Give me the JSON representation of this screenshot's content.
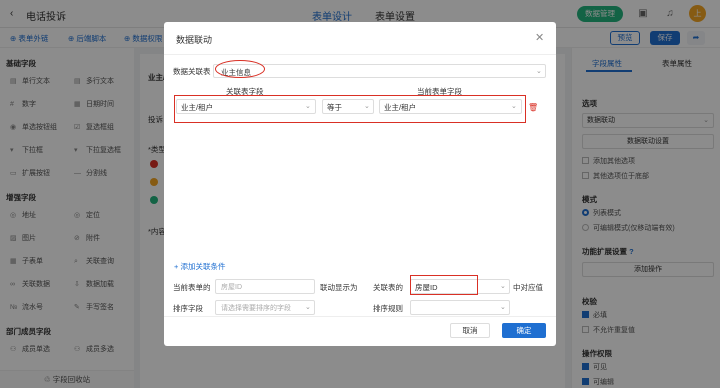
{
  "topbar": {
    "back_icon": "chevron-left-icon",
    "title": "电话投诉",
    "tabs": [
      {
        "label": "表单设计",
        "active": true
      },
      {
        "label": "表单设置",
        "active": false
      }
    ],
    "data_manage": "数据管理",
    "avatar_text": "上"
  },
  "subbar": {
    "items": [
      "表单外链",
      "后端脚本",
      "数据权限"
    ],
    "preview": "预览",
    "save": "保存"
  },
  "left": {
    "sections": [
      {
        "title": "基础字段",
        "fields": [
          "单行文本",
          "多行文本",
          "数字",
          "日期时间",
          "单选按钮组",
          "复选框组",
          "下拉框",
          "下拉复选框",
          "扩展按钮",
          "分割线"
        ]
      },
      {
        "title": "增强字段",
        "fields": [
          "地址",
          "定位",
          "图片",
          "附件",
          "子表单",
          "关联查询",
          "关联数据",
          "数据加载",
          "流水号",
          "手写签名"
        ]
      },
      {
        "title": "部门成员字段",
        "fields": [
          "成员单选",
          "成员多选"
        ]
      }
    ],
    "footer": "字段回收站"
  },
  "canvas": {
    "texts": [
      "业主/",
      "投诉",
      "*类型",
      "*内容"
    ]
  },
  "right": {
    "tabs": [
      {
        "label": "字段属性",
        "active": true
      },
      {
        "label": "表单属性",
        "active": false
      }
    ],
    "options_label": "选项",
    "options_select": "数据联动",
    "linkage_btn": "数据联动设置",
    "add_other": "添加其他选项",
    "other_bottom": "其他选项位于底部",
    "mode_label": "模式",
    "mode_list": "列表模式",
    "mode_edit": "可编辑模式(仅移动端有效)",
    "ext_label": "功能扩展设置",
    "add_action": "添加操作",
    "verify_label": "校验",
    "required": "必填",
    "no_dup": "不允许重复值",
    "perm_label": "操作权限",
    "visible": "可见",
    "editable": "可编辑"
  },
  "modal": {
    "title": "数据联动",
    "assoc_table_label": "数据关联表",
    "assoc_table_value": "业主信息",
    "col_left": "关联表字段",
    "col_right": "当前表单字段",
    "map_left": "业主/租户",
    "map_op": "等于",
    "map_right": "业主/租户",
    "add_condition": "+ 添加关联条件",
    "current_table_prefix": "当前表单的",
    "current_field_placeholder": "房屋ID",
    "linked_display": "联动显示为",
    "assoc_table_of": "关联表的",
    "assoc_field_value": "房屋ID",
    "corresponding": "中对应值",
    "sort_field_label": "排序字段",
    "sort_field_placeholder": "请选择需要排序的字段",
    "sort_rule_label": "排序规则",
    "cancel": "取消",
    "confirm": "确定"
  }
}
